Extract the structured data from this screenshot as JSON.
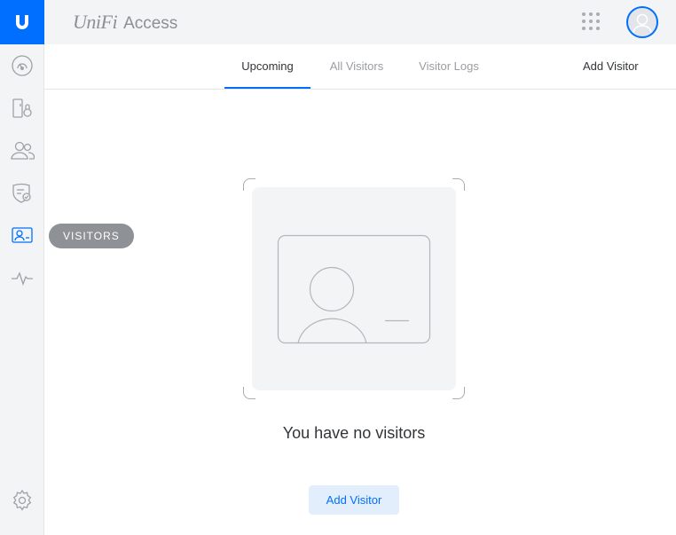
{
  "app": {
    "brand_unifi": "UniFi",
    "brand_access": "Access"
  },
  "sidebar": {
    "tooltip": "VISITORS",
    "items": [
      {
        "icon": "dashboard-icon"
      },
      {
        "icon": "doors-icon"
      },
      {
        "icon": "users-icon"
      },
      {
        "icon": "access-policy-icon"
      },
      {
        "icon": "visitors-icon",
        "active": true
      },
      {
        "icon": "activity-icon"
      },
      {
        "icon": "settings-icon"
      }
    ]
  },
  "tabs": [
    {
      "label": "Upcoming",
      "active": true
    },
    {
      "label": "All Visitors",
      "active": false
    },
    {
      "label": "Visitor Logs",
      "active": false
    }
  ],
  "header": {
    "add_visitor_label": "Add Visitor"
  },
  "empty_state": {
    "message": "You have no visitors",
    "button_label": "Add Visitor"
  },
  "colors": {
    "accent": "#006fff",
    "sidebar_bg": "#f3f4f5",
    "text_primary": "#323538",
    "text_muted": "#9a9da2"
  }
}
